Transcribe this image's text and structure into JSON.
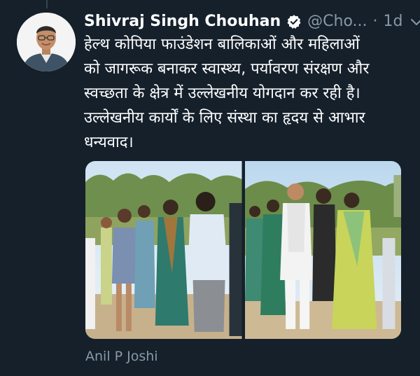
{
  "tweet": {
    "display_name": "Shivraj Singh Chouhan",
    "handle": "@Cho...",
    "separator": "·",
    "time": "1d",
    "text_lines": [
      "हेल्थ कोपिया फाउंडेशन बालिकाओं और महिलाओं",
      "को जागरूक बनाकर स्वास्थ्य, पर्यावरण संरक्षण और",
      "स्वच्छता के क्षेत्र में उल्लेखनीय योगदान कर रही है।",
      "उल्लेखनीय कार्यों के लिए संस्था का हृदय से आभार",
      "धन्यवाद।"
    ],
    "media": [
      {
        "kind": "photo",
        "subject": "group-photo-left"
      },
      {
        "kind": "photo",
        "subject": "group-photo-right"
      }
    ],
    "source_credit": "Anil P Joshi"
  },
  "icons": {
    "verified": "verified-badge-icon",
    "menu": "chevron-down-icon"
  },
  "colors": {
    "background": "#15202b",
    "primary_text": "#ffffff",
    "secondary_text": "#8899a6",
    "verified": "#ffffff"
  }
}
